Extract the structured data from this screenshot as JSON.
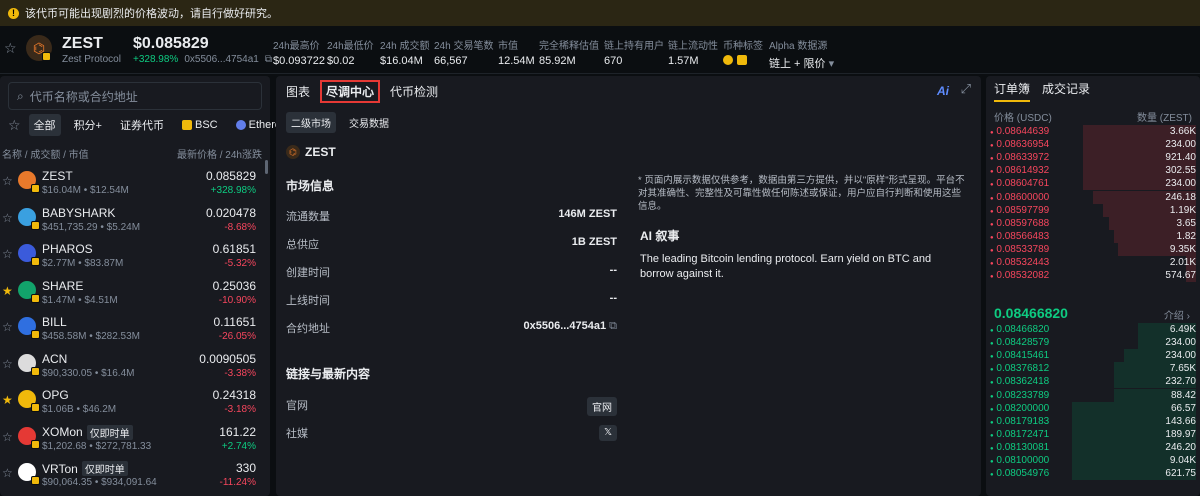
{
  "warning": "该代币可能出现剧烈的价格波动，请自行做好研究。",
  "token": {
    "symbol": "ZEST",
    "name": "Zest Protocol",
    "price": "$0.085829",
    "change": "+328.98%",
    "address": "0x5506...4754a1"
  },
  "stats": [
    {
      "label": "24h最高价",
      "value": "$0.093722"
    },
    {
      "label": "24h最低价",
      "value": "$0.02"
    },
    {
      "label": "24h 成交额",
      "value": "$16.04M"
    },
    {
      "label": "24h 交易笔数",
      "value": "66,567"
    },
    {
      "label": "市值",
      "value": "12.54M"
    },
    {
      "label": "完全稀释估值",
      "value": "85.92M"
    },
    {
      "label": "链上持有用户",
      "value": "670"
    },
    {
      "label": "链上流动性",
      "value": "1.57M"
    },
    {
      "label": "币种标签",
      "value": ""
    },
    {
      "label": "Alpha 数据源",
      "value": "链上 + 限价"
    }
  ],
  "search_placeholder": "代币名称或合约地址",
  "filters": [
    "全部",
    "积分+",
    "证券代币",
    "BSC",
    "Ethereum"
  ],
  "list_header": {
    "left": "名称 / 成交额 / 市值",
    "right": "最新价格 / 24h涨跌"
  },
  "list": [
    {
      "name": "ZEST",
      "sub": "$16.04M • $12.54M",
      "price": "0.085829",
      "change": "+328.98%",
      "up": true,
      "star": false,
      "color": "#e8792b",
      "tag": ""
    },
    {
      "name": "BABYSHARK",
      "sub": "$451,735.29 • $5.24M",
      "price": "0.020478",
      "change": "-8.68%",
      "up": false,
      "star": false,
      "color": "#3aa0e0",
      "tag": ""
    },
    {
      "name": "PHAROS",
      "sub": "$2.77M • $83.87M",
      "price": "0.61851",
      "change": "-5.32%",
      "up": false,
      "star": false,
      "color": "#3b5bdb",
      "tag": ""
    },
    {
      "name": "SHARE",
      "sub": "$1.47M • $4.51M",
      "price": "0.25036",
      "change": "-10.90%",
      "up": false,
      "star": true,
      "color": "#12a36b",
      "tag": ""
    },
    {
      "name": "BILL",
      "sub": "$458.58M • $282.53M",
      "price": "0.11651",
      "change": "-26.05%",
      "up": false,
      "star": false,
      "color": "#2f6fe0",
      "tag": ""
    },
    {
      "name": "ACN",
      "sub": "$90,330.05 • $16.4M",
      "price": "0.0090505",
      "change": "-3.38%",
      "up": false,
      "star": false,
      "color": "#dcdcdc",
      "tag": ""
    },
    {
      "name": "OPG",
      "sub": "$1.06B • $46.2M",
      "price": "0.24318",
      "change": "-3.18%",
      "up": false,
      "star": true,
      "color": "#f0b90b",
      "tag": ""
    },
    {
      "name": "XOMon",
      "sub": "$1,202.68 • $272,781.33",
      "price": "161.22",
      "change": "+2.74%",
      "up": true,
      "star": false,
      "color": "#e53935",
      "tag": "仅即时单"
    },
    {
      "name": "VRTon",
      "sub": "$90,064.35 • $934,091.64",
      "price": "330",
      "change": "-11.24%",
      "up": false,
      "star": false,
      "color": "#ffffff",
      "tag": "仅即时单"
    }
  ],
  "mid_tabs": [
    "图表",
    "尽调中心",
    "代币检测"
  ],
  "mid_subtabs": [
    "二级市场",
    "交易数据"
  ],
  "ai_label": "Ai",
  "market": {
    "title": "市场信息",
    "rows": [
      {
        "k": "流通数量",
        "v": "146M ZEST"
      },
      {
        "k": "总供应",
        "v": "1B ZEST"
      },
      {
        "k": "创建时间",
        "v": "--"
      },
      {
        "k": "上线时间",
        "v": "--"
      },
      {
        "k": "合约地址",
        "v": "0x5506...4754a1"
      }
    ]
  },
  "links": {
    "title": "链接与最新内容",
    "website": "官网",
    "website_btn": "官网",
    "social": "社媒",
    "social_btn": "𝕏"
  },
  "disclaimer": "* 页面内展示数据仅供参考，数据由第三方提供，并以\"原样\"形式呈现。平台不对其准确性、完整性及可靠性做任何陈述或保证，用户应自行判断和使用这些信息。",
  "ai_story": {
    "title": "AI 叙事",
    "text": "The leading Bitcoin lending protocol. Earn yield on BTC and borrow against it."
  },
  "orderbook": {
    "tabs": [
      "订单簿",
      "成交记录"
    ],
    "col_price": "价格 (USDC)",
    "col_qty": "数量 (ZEST)",
    "asks": [
      {
        "p": "0.08644639",
        "q": "3.66K",
        "w": 0.55
      },
      {
        "p": "0.08636954",
        "q": "234.00",
        "w": 0.55
      },
      {
        "p": "0.08633972",
        "q": "921.40",
        "w": 0.55
      },
      {
        "p": "0.08614932",
        "q": "302.55",
        "w": 0.55
      },
      {
        "p": "0.08604761",
        "q": "234.00",
        "w": 0.55
      },
      {
        "p": "0.08600000",
        "q": "246.18",
        "w": 0.5
      },
      {
        "p": "0.08597799",
        "q": "1.19K",
        "w": 0.45
      },
      {
        "p": "0.08597688",
        "q": "3.65",
        "w": 0.42
      },
      {
        "p": "0.08566483",
        "q": "1.82",
        "w": 0.4
      },
      {
        "p": "0.08533789",
        "q": "9.35K",
        "w": 0.38
      },
      {
        "p": "0.08532443",
        "q": "2.01K",
        "w": 0.05
      },
      {
        "p": "0.08532082",
        "q": "574.67",
        "w": 0.05
      }
    ],
    "mid_price": "0.08466820",
    "intro": "介绍",
    "bids": [
      {
        "p": "0.08466820",
        "q": "6.49K",
        "w": 0.28
      },
      {
        "p": "0.08428579",
        "q": "234.00",
        "w": 0.28
      },
      {
        "p": "0.08415461",
        "q": "234.00",
        "w": 0.35
      },
      {
        "p": "0.08376812",
        "q": "7.65K",
        "w": 0.4
      },
      {
        "p": "0.08362418",
        "q": "232.70",
        "w": 0.4
      },
      {
        "p": "0.08233789",
        "q": "88.42",
        "w": 0.4
      },
      {
        "p": "0.08200000",
        "q": "66.57",
        "w": 0.6
      },
      {
        "p": "0.08179183",
        "q": "143.66",
        "w": 0.6
      },
      {
        "p": "0.08172471",
        "q": "189.97",
        "w": 0.6
      },
      {
        "p": "0.08130081",
        "q": "246.20",
        "w": 0.6
      },
      {
        "p": "0.08100000",
        "q": "9.04K",
        "w": 0.6
      },
      {
        "p": "0.08054976",
        "q": "621.75",
        "w": 0.6
      }
    ]
  }
}
